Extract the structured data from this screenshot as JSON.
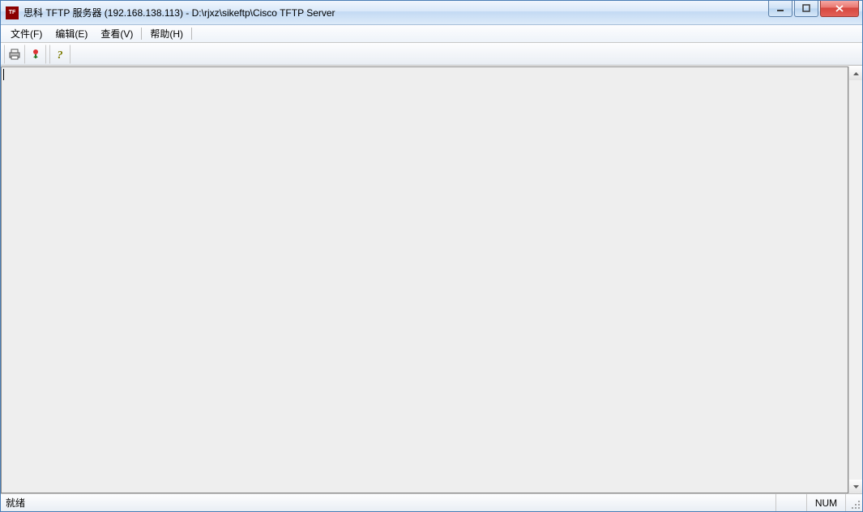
{
  "titlebar": {
    "title": "思科 TFTP 服务器 (192.168.138.113) - D:\\rjxz\\sikeftp\\Cisco TFTP Server",
    "icon_name": "cisco-tftp-icon"
  },
  "menubar": {
    "items": [
      {
        "label": "文件(F)"
      },
      {
        "label": "编辑(E)"
      },
      {
        "label": "查看(V)"
      },
      {
        "label": "帮助(H)"
      }
    ]
  },
  "toolbar": {
    "buttons": [
      {
        "name": "print-icon"
      },
      {
        "name": "options-icon"
      },
      {
        "name": "help-icon"
      }
    ]
  },
  "content": {
    "text": ""
  },
  "statusbar": {
    "ready": "就绪",
    "num": "NUM"
  }
}
